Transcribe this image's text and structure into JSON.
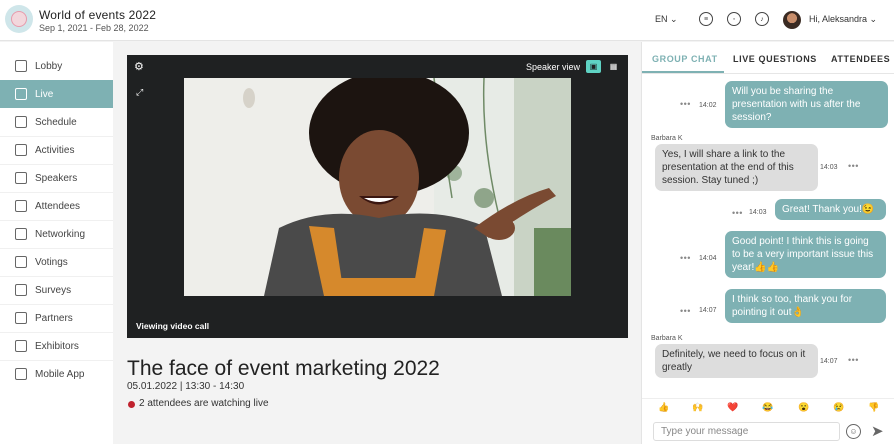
{
  "header": {
    "event_title": "World of events 2022",
    "event_dates": "Sep 1, 2021 - Feb 28, 2022",
    "language": "EN",
    "greeting": "Hi, Aleksandra"
  },
  "sidebar": {
    "items": [
      {
        "label": "Lobby",
        "icon": "home-icon"
      },
      {
        "label": "Live",
        "icon": "live-icon"
      },
      {
        "label": "Schedule",
        "icon": "calendar-icon"
      },
      {
        "label": "Activities",
        "icon": "calendar-icon"
      },
      {
        "label": "Speakers",
        "icon": "user-icon"
      },
      {
        "label": "Attendees",
        "icon": "users-icon"
      },
      {
        "label": "Networking",
        "icon": "handshake-icon"
      },
      {
        "label": "Votings",
        "icon": "vote-icon"
      },
      {
        "label": "Surveys",
        "icon": "survey-icon"
      },
      {
        "label": "Partners",
        "icon": "partners-icon"
      },
      {
        "label": "Exhibitors",
        "icon": "exhibitors-icon"
      },
      {
        "label": "Mobile App",
        "icon": "phone-icon"
      }
    ],
    "active": "Live"
  },
  "video": {
    "speaker_view_label": "Speaker view",
    "caption": "Viewing video call"
  },
  "session": {
    "title": "The face of event marketing 2022",
    "time": "05.01.2022 | 13:30 - 14:30",
    "watching": "2 attendees are watching live"
  },
  "chat": {
    "tabs": [
      "GROUP CHAT",
      "LIVE QUESTIONS",
      "ATTENDEES"
    ],
    "active_tab": "GROUP CHAT",
    "messages": [
      {
        "from": "me",
        "time": "14:02",
        "text": "Will you be sharing the presentation with us after the session?"
      },
      {
        "from": "Barbara K",
        "time": "14:03",
        "text": "Yes, I will share a link to the presentation at the end of this session. Stay tuned ;)"
      },
      {
        "from": "me",
        "time": "14:03",
        "text": "Great! Thank you!😉"
      },
      {
        "from": "me",
        "time": "14:04",
        "text": "Good point! I think this is going to be a very important issue this year!👍👍"
      },
      {
        "from": "me",
        "time": "14:07",
        "text": "I think so too, thank you for pointing it out👌"
      },
      {
        "from": "Barbara K",
        "time": "14:07",
        "text": "Definitely, we need to focus on it greatly"
      }
    ],
    "reactions": [
      "👍",
      "🙌",
      "❤️",
      "😂",
      "😮",
      "😢",
      "👎"
    ],
    "input_placeholder": "Type your message"
  },
  "colors": {
    "accent": "#7eb1b3",
    "video_bg": "#1f2122",
    "live_dot": "#c0222e"
  }
}
